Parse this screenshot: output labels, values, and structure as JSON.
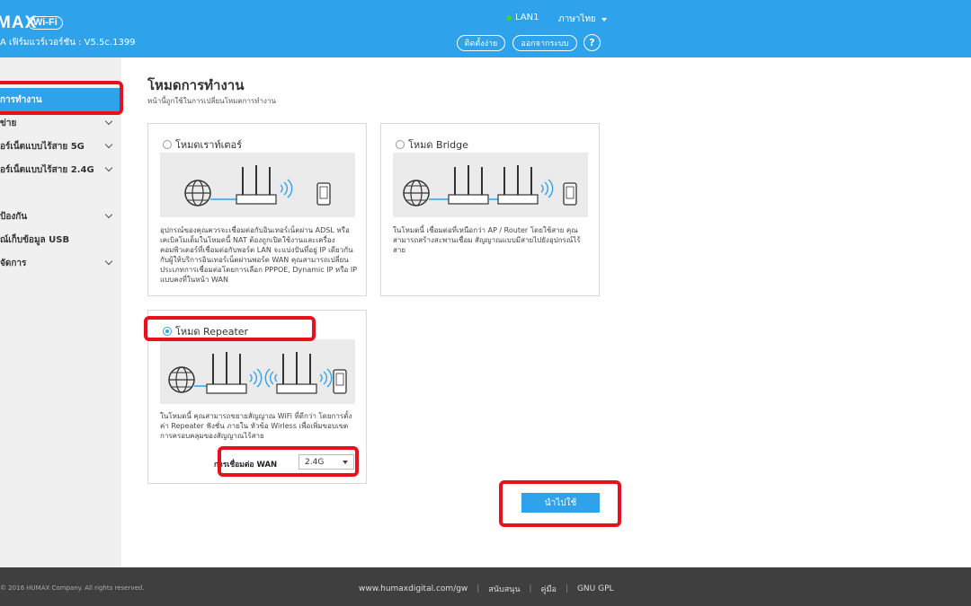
{
  "header": {
    "logo": "MAX",
    "logo_badge": "Wi-Fi",
    "firmware": "A เฟิร์มแวร์เวอร์ชัน : V5.5c.1399",
    "lan_status": "LAN1",
    "language": "ภาษาไทย",
    "setup_button": "ติดตั้งง่าย",
    "logout_button": "ออกจากระบบ",
    "help": "?"
  },
  "sidebar": {
    "items": [
      {
        "label": "การทำงาน",
        "active": true,
        "chevron": false
      },
      {
        "label": "ข่าย",
        "active": false,
        "chevron": true
      },
      {
        "label": "อร์เน็ตแบบไร้สาย 5G",
        "active": false,
        "chevron": true
      },
      {
        "label": "อร์เน็ตแบบไร้สาย 2.4G",
        "active": false,
        "chevron": true
      },
      {
        "label": "ป้องกัน",
        "active": false,
        "chevron": true
      },
      {
        "label": "ณ์เก็บข้อมูล USB",
        "active": false,
        "chevron": false
      },
      {
        "label": "จัดการ",
        "active": false,
        "chevron": true
      }
    ]
  },
  "main": {
    "title": "โหมดการทำงาน",
    "subtitle": "หน้านี้ถูกใช้ในการเปลี่ยนโหมดการทำงาน",
    "router_mode": {
      "label": "โหมดเราท์เตอร์",
      "selected": false,
      "description": "อุปกรณ์ของคุณควรจะเชื่อมต่อกับอินเทอร์เน็ตผ่าน ADSL หรือเคเบิลโมเด็มในโหมดนี้ NAT ต้องถูกเปิดใช้งานและเครื่องคอมพิวเตอร์ที่เชื่อมต่อกับพอร์ต LAN จะแบ่งปันที่อยู่ IP เดียวกันกับผู้ให้บริการอินเทอร์เน็ตผ่านพอร์ต WAN คุณสามารถเปลี่ยนประเภทการเชื่อมต่อโดยการเลือก PPPOE, Dynamic IP หรือ IP แบบคงที่ในหน้า WAN"
    },
    "bridge_mode": {
      "label": "โหมด Bridge",
      "selected": false,
      "description": "ในโหมดนี้ เชื่อมต่อที่เหนือกว่า AP / Router โดยใช้สาย คุณสามารถสร้างสะพานเชื่อม สัญญาณแบบมีสายไปยังอุปกรณ์ไร้สาย"
    },
    "repeater_mode": {
      "label": "โหมด Repeater",
      "selected": true,
      "description": "ในโหมดนี้ คุณสามารถขยายสัญญาณ WiFi ที่ดีกว่า โดยการตั้งค่า Repeater ฟังชั่น ภายใน หัวข้อ Wirless เพื่อเพิ่มขอบเขตการครอบคลุมของสัญญาณไร้สาย",
      "wan_label": "การเชื่อมต่อ WAN",
      "wan_value": "2.4G"
    },
    "apply_button": "นำไปใช้"
  },
  "footer": {
    "copyright": "© 2016 HUMAX Company. All rights reserved.",
    "links": [
      "www.humaxdigital.com/gw",
      "สนับสนุน",
      "คู่มือ",
      "GNU GPL"
    ]
  },
  "colors": {
    "accent": "#2fa2ec",
    "highlight": "#e8111b",
    "footer_bg": "#3f3f3f",
    "sidebar_bg": "#f0f0f0"
  },
  "icons": {
    "globe": "globe-icon",
    "router": "router-icon",
    "wifi": "wifi-waves-icon",
    "phone": "smartphone-icon"
  }
}
